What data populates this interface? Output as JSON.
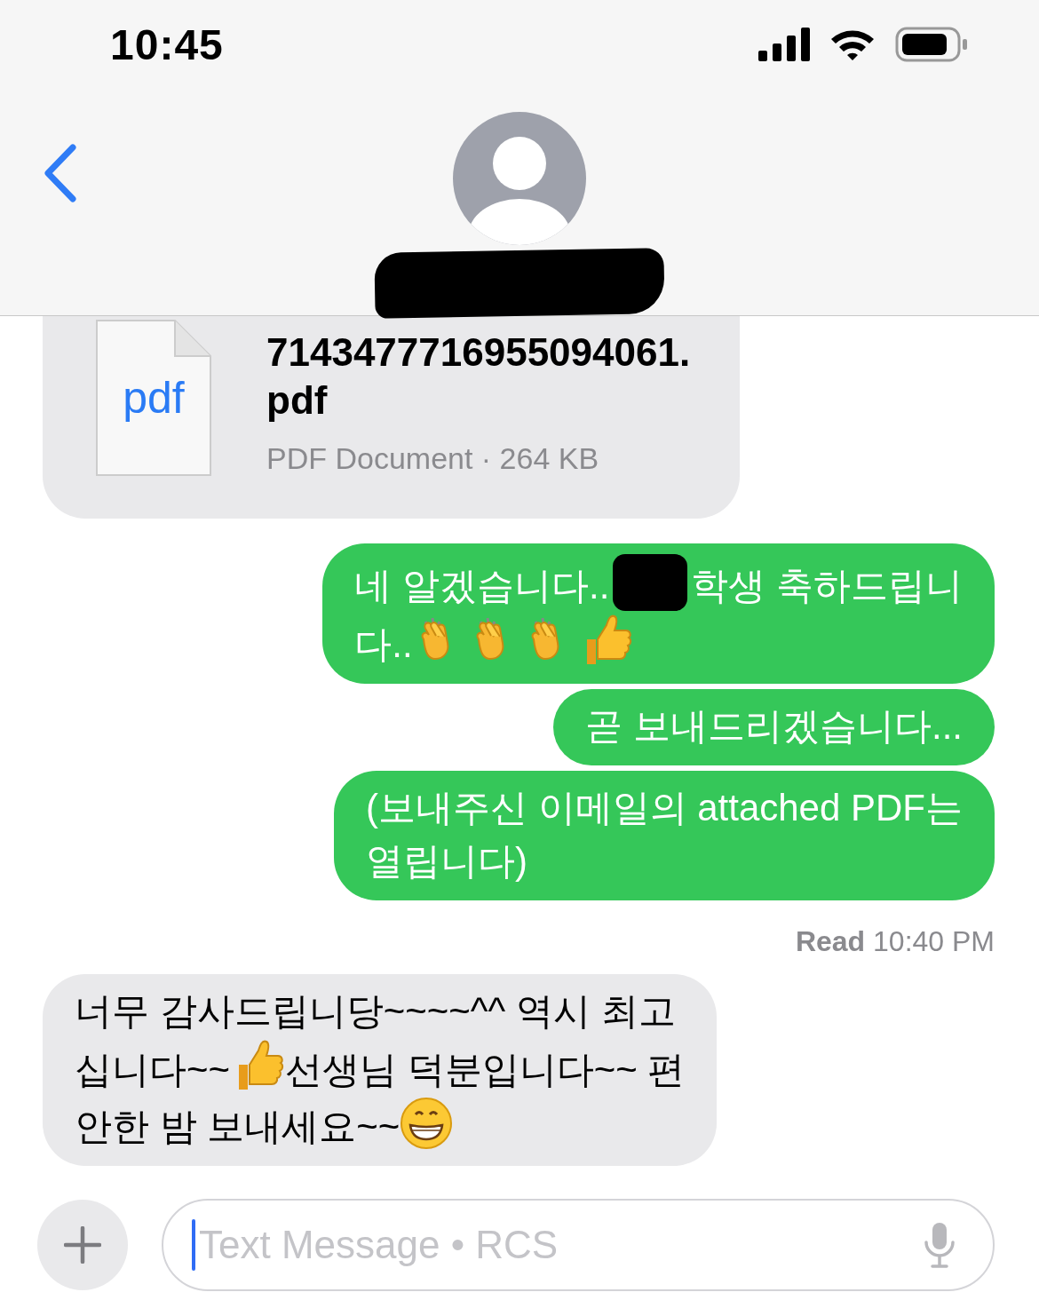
{
  "status_bar": {
    "time": "10:45"
  },
  "messages": [
    {
      "kind": "file",
      "file_type": "pdf",
      "file_name": "7143477716955094061.pdf",
      "detail": "PDF Document · 264 KB"
    },
    {
      "kind": "sent",
      "lines": [
        [
          {
            "kind": "text",
            "text": "네 알겠습니다.."
          },
          {
            "kind": "redacted"
          },
          {
            "kind": "text",
            "text": "학생 축하드립니"
          }
        ],
        [
          {
            "kind": "text",
            "text": "다.."
          },
          {
            "kind": "clap"
          },
          {
            "kind": "clap"
          },
          {
            "kind": "clap"
          },
          {
            "kind": "thumbs-up"
          }
        ]
      ]
    },
    {
      "kind": "sent",
      "lines": [
        [
          {
            "kind": "text",
            "text": "곧 보내드리겠습니다..."
          }
        ]
      ]
    },
    {
      "kind": "sent",
      "lines": [
        [
          {
            "kind": "text",
            "text": "(보내주신 이메일의 attached PDF는"
          }
        ],
        [
          {
            "kind": "text",
            "text": "열립니다)"
          }
        ]
      ]
    },
    {
      "kind": "receipt",
      "label": "Read",
      "time": "10:40 PM"
    },
    {
      "kind": "received",
      "lines": [
        [
          {
            "kind": "text",
            "text": "너무 감사드립니당~~~~^^ 역시 최고"
          }
        ],
        [
          {
            "kind": "text",
            "text": "십니다~~"
          },
          {
            "kind": "thumbs-up"
          },
          {
            "kind": "text",
            "text": "선생님 덕분입니다~~ 편"
          }
        ],
        [
          {
            "kind": "text",
            "text": "안한 밤 보내세요~~"
          },
          {
            "kind": "grin"
          }
        ]
      ]
    }
  ],
  "compose": {
    "placeholder": "Text Message • RCS"
  }
}
